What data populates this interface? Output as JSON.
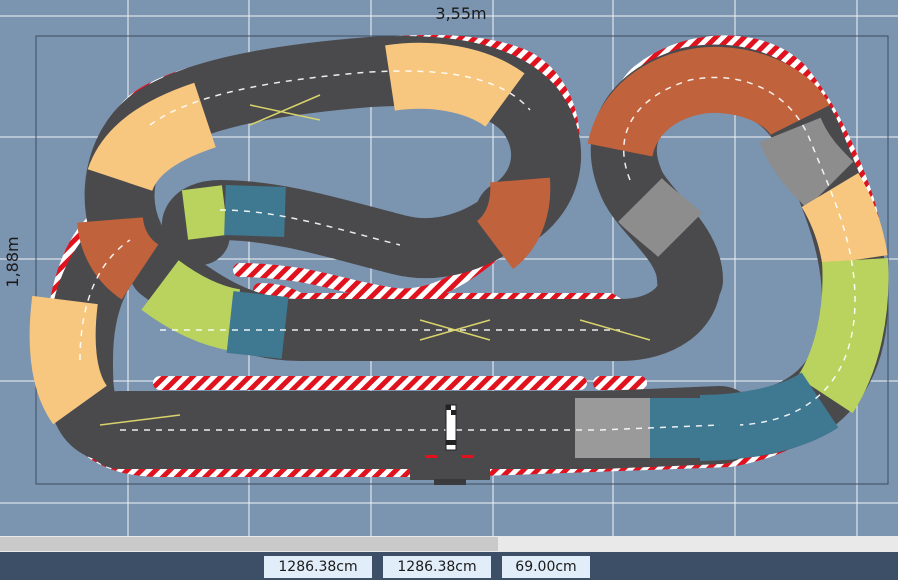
{
  "dimensions": {
    "width_label": "3,55m",
    "height_label": "1,88m"
  },
  "status": {
    "x_value": "1286.38cm",
    "y_value": "1286.38cm",
    "z_value": "69.00cm"
  },
  "colors": {
    "background": "#7b94b0",
    "grid": "#ffffff",
    "asphalt": "#4a4a4d",
    "border_red": "#e0121e",
    "section_orange": "#f8c77f",
    "section_rust": "#c0623c",
    "section_green": "#b9d35e",
    "section_blue": "#3f7891",
    "section_grey": "#8d8d8d"
  }
}
